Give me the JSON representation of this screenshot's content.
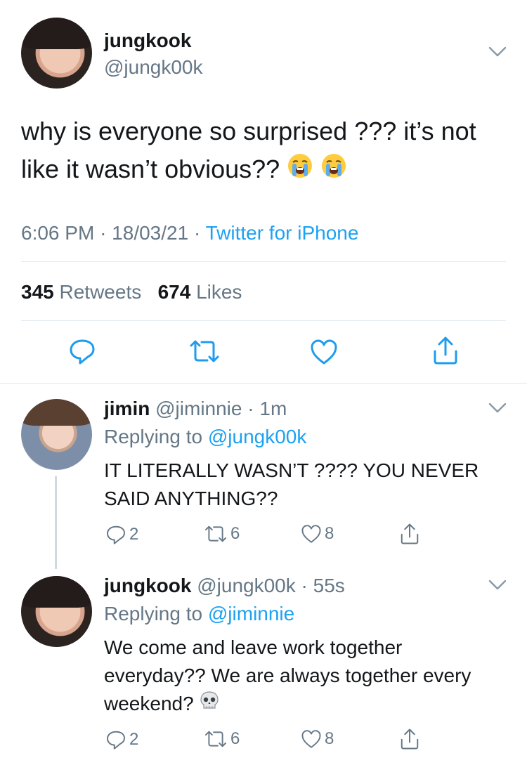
{
  "main_tweet": {
    "display_name": "jungkook",
    "handle": "@jungk00k",
    "text": "why is everyone so surprised ??? it’s not like it wasn’t obvious??",
    "emojis": [
      "loudly-crying-face",
      "loudly-crying-face"
    ],
    "time": "6:06 PM",
    "date": "18/03/21",
    "separator": "·",
    "source": "Twitter for iPhone",
    "retweet_count": "345",
    "retweet_label": "Retweets",
    "like_count": "674",
    "like_label": "Likes",
    "actions": [
      "reply-icon",
      "retweet-icon",
      "like-icon",
      "share-icon"
    ]
  },
  "replies": [
    {
      "display_name": "jimin",
      "handle": "@jiminnie",
      "time": "1m",
      "replying_prefix": "Replying to",
      "replying_to": "@jungk00k",
      "text": "IT LITERALLY WASN’T ???? YOU NEVER SAID ANYTHING??",
      "reply_count": "2",
      "retweet_count": "6",
      "like_count": "8"
    },
    {
      "display_name": "jungkook",
      "handle": "@jungk00k",
      "time": "55s",
      "replying_prefix": "Replying to",
      "replying_to": "@jiminnie",
      "text": "We come and leave work together everyday?? We are always together every weekend?",
      "emoji": "skull",
      "reply_count": "2",
      "retweet_count": "6",
      "like_count": "8"
    }
  ],
  "colors": {
    "text": "#14171a",
    "secondary": "#657786",
    "link": "#1da1f2",
    "divider": "#e1e8ed"
  }
}
